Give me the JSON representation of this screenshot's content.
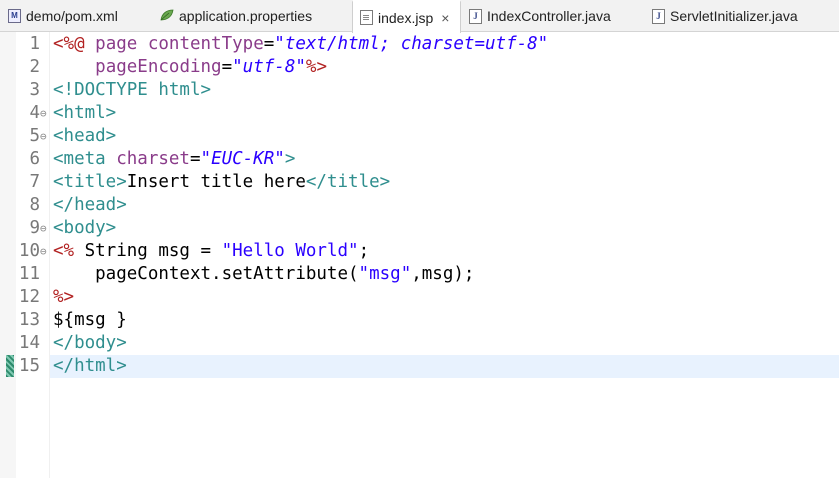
{
  "tabs": [
    {
      "label": "demo/pom.xml",
      "icon": "maven-m-icon"
    },
    {
      "label": "application.properties",
      "icon": "leaf-icon"
    },
    {
      "label": "index.jsp",
      "icon": "file-icon",
      "active": true,
      "close": "×"
    },
    {
      "label": "IndexController.java",
      "icon": "java-file-icon"
    },
    {
      "label": "ServletInitializer.java",
      "icon": "java-file-icon"
    }
  ],
  "editor": {
    "current_line": 15,
    "lines": [
      {
        "n": "1",
        "fold": "",
        "tokens": [
          {
            "c": "dl",
            "t": "<%@ "
          },
          {
            "c": "an",
            "t": "page contentType"
          },
          {
            "c": "pl",
            "t": "="
          },
          {
            "c": "av",
            "t": "\"text/html; charset=utf-8\""
          }
        ]
      },
      {
        "n": "2",
        "fold": "",
        "tokens": [
          {
            "c": "pl",
            "t": "    "
          },
          {
            "c": "an",
            "t": "pageEncoding"
          },
          {
            "c": "pl",
            "t": "="
          },
          {
            "c": "av",
            "t": "\"utf-8\""
          },
          {
            "c": "dl",
            "t": "%>"
          }
        ]
      },
      {
        "n": "3",
        "fold": "",
        "tokens": [
          {
            "c": "tg",
            "t": "<!DOCTYPE html>"
          }
        ]
      },
      {
        "n": "4",
        "fold": "⊖",
        "tokens": [
          {
            "c": "tg",
            "t": "<html>"
          }
        ]
      },
      {
        "n": "5",
        "fold": "⊖",
        "tokens": [
          {
            "c": "tg",
            "t": "<head>"
          }
        ]
      },
      {
        "n": "6",
        "fold": "",
        "tokens": [
          {
            "c": "tg",
            "t": "<meta "
          },
          {
            "c": "an",
            "t": "charset"
          },
          {
            "c": "pl",
            "t": "="
          },
          {
            "c": "av",
            "t": "\"EUC-KR\""
          },
          {
            "c": "tg",
            "t": ">"
          }
        ]
      },
      {
        "n": "7",
        "fold": "",
        "tokens": [
          {
            "c": "tg",
            "t": "<title>"
          },
          {
            "c": "pl",
            "t": "Insert title here"
          },
          {
            "c": "tg",
            "t": "</title>"
          }
        ]
      },
      {
        "n": "8",
        "fold": "",
        "tokens": [
          {
            "c": "tg",
            "t": "</head>"
          }
        ]
      },
      {
        "n": "9",
        "fold": "⊖",
        "tokens": [
          {
            "c": "tg",
            "t": "<body>"
          }
        ]
      },
      {
        "n": "10",
        "fold": "⊖",
        "tokens": [
          {
            "c": "dl",
            "t": "<%"
          },
          {
            "c": "pl",
            "t": " String msg = "
          },
          {
            "c": "st",
            "t": "\"Hello World\""
          },
          {
            "c": "pl",
            "t": ";"
          }
        ]
      },
      {
        "n": "11",
        "fold": "",
        "tokens": [
          {
            "c": "pl",
            "t": "    pageContext.setAttribute("
          },
          {
            "c": "st",
            "t": "\"msg\""
          },
          {
            "c": "pl",
            "t": ",msg);"
          }
        ]
      },
      {
        "n": "12",
        "fold": "",
        "tokens": [
          {
            "c": "dl",
            "t": "%>"
          }
        ]
      },
      {
        "n": "13",
        "fold": "",
        "tokens": [
          {
            "c": "pl",
            "t": "${msg }"
          }
        ]
      },
      {
        "n": "14",
        "fold": "",
        "tokens": [
          {
            "c": "tg",
            "t": "</body>"
          }
        ]
      },
      {
        "n": "15",
        "fold": "",
        "tokens": [
          {
            "c": "tg",
            "t": "</html>"
          }
        ]
      }
    ]
  },
  "colors": {
    "tag": "#2f8e8e",
    "attribute_name": "#8a3c8a",
    "attribute_value": "#2a00ff",
    "jsp_delimiter": "#b22222",
    "string": "#2a00ff",
    "current_line_highlight": "#e8f2fe"
  }
}
